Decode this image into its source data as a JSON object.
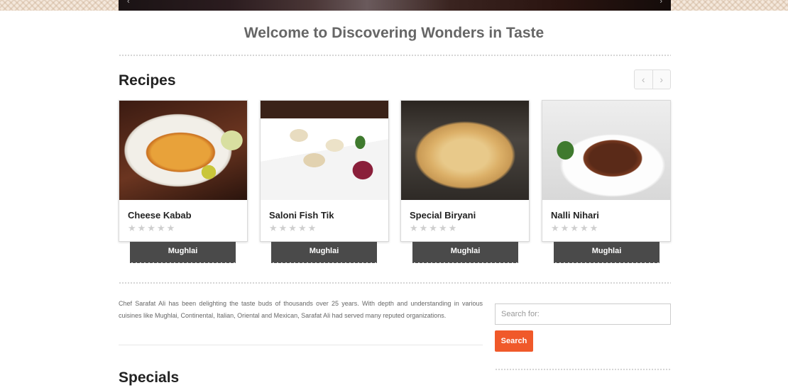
{
  "welcome": "Welcome to Discovering Wonders in Taste",
  "recipes_title": "Recipes",
  "pager": {
    "prev": "‹",
    "next": "›"
  },
  "recipes": [
    {
      "name": "Cheese Kabab",
      "stars": "★★★★★",
      "cuisine": "Mughlai",
      "rating": 0
    },
    {
      "name": "Saloni Fish Tik",
      "stars": "★★★★★",
      "cuisine": "Mughlai",
      "rating": 0
    },
    {
      "name": "Special Biryani",
      "stars": "★★★★★",
      "cuisine": "Mughlai",
      "rating": 0
    },
    {
      "name": "Nalli Nihari",
      "stars": "★★★★★",
      "cuisine": "Mughlai",
      "rating": 0
    }
  ],
  "about": "Chef Sarafat Ali has been delighting the taste buds of thousands over 25 years. With depth and understanding in various cuisines like Mughlai, Continental, Italian, Oriental and Mexican, Sarafat Ali had served many reputed organizations.",
  "search": {
    "placeholder": "Search for:",
    "button": "Search"
  },
  "specials_title": "Specials",
  "colors": {
    "accent": "#f0592a",
    "ribbon": "#4a4a4a"
  }
}
